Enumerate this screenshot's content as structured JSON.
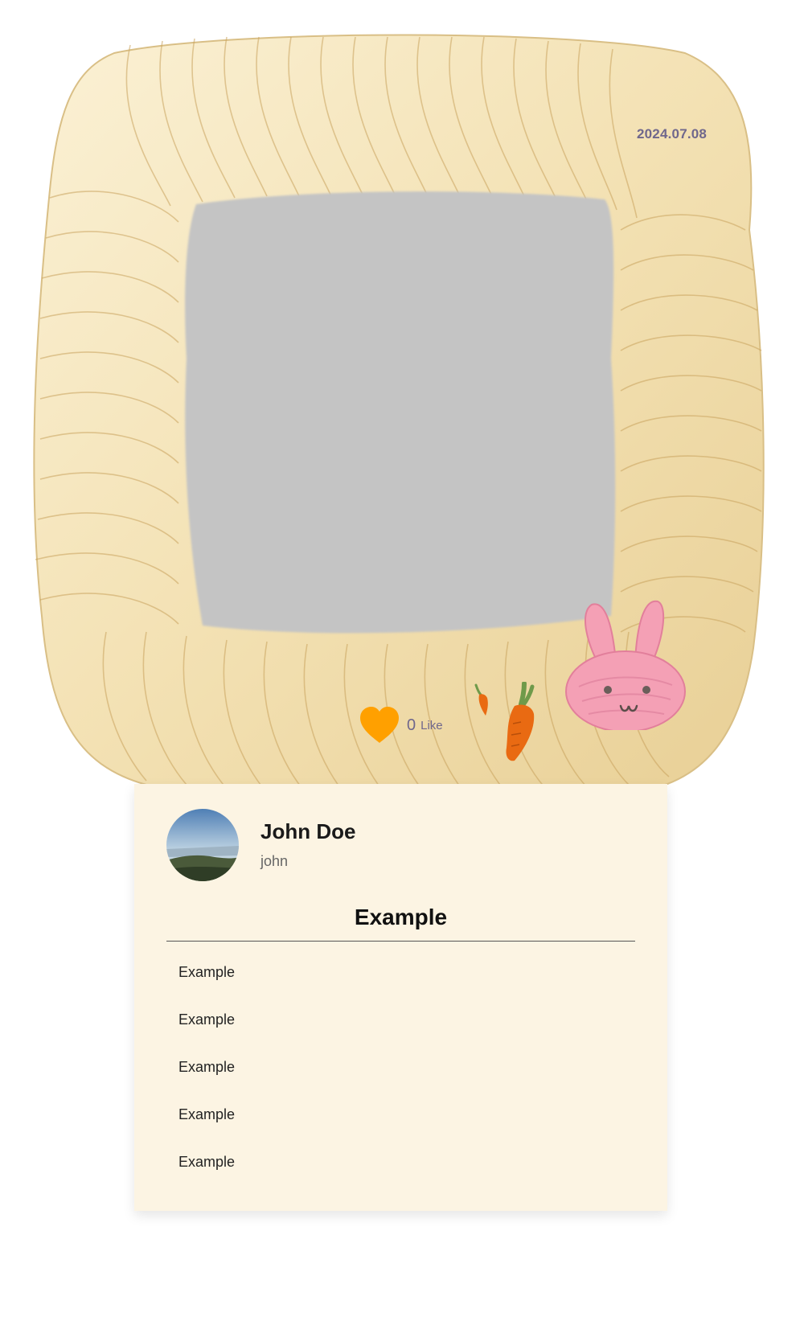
{
  "post": {
    "date": "2024.07.08",
    "likes": {
      "count": "0",
      "label": "Like"
    }
  },
  "profile": {
    "name": "John Doe",
    "username": "john"
  },
  "section": {
    "title": "Example",
    "items": [
      "Example",
      "Example",
      "Example",
      "Example",
      "Example"
    ]
  },
  "colors": {
    "frame": "#f2e0b2",
    "frame_shadow": "#d8b774",
    "photo_placeholder": "#c4c4c4",
    "card_bg": "#fcf4e3",
    "heart": "#ffa000",
    "muted_text": "#6f678c",
    "bunny": "#f4a0b5",
    "carrot": "#e96a12",
    "leaf": "#6f9a4a"
  },
  "icons": {
    "heart": "heart-icon",
    "carrot": "carrot-icon",
    "bunny": "bunny-sticker"
  }
}
